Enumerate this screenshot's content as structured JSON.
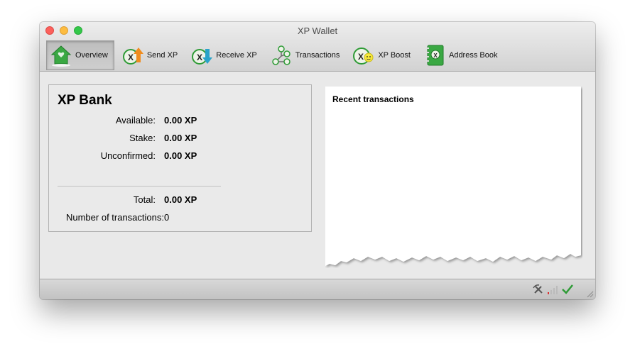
{
  "window": {
    "title": "XP Wallet"
  },
  "toolbar": {
    "items": [
      {
        "label": "Overview",
        "icon": "home-icon",
        "active": true
      },
      {
        "label": "Send XP",
        "icon": "send-coin-icon"
      },
      {
        "label": "Receive XP",
        "icon": "receive-coin-icon"
      },
      {
        "label": "Transactions",
        "icon": "transactions-tree-icon"
      },
      {
        "label": "XP Boost",
        "icon": "boost-icon"
      },
      {
        "label": "Address Book",
        "icon": "address-book-icon"
      }
    ]
  },
  "bank": {
    "title": "XP Bank",
    "available_label": "Available:",
    "available_value": "0.00 XP",
    "stake_label": "Stake:",
    "stake_value": "0.00 XP",
    "unconfirmed_label": "Unconfirmed:",
    "unconfirmed_value": "0.00 XP",
    "total_label": "Total:",
    "total_value": "0.00 XP",
    "tx_count_label": "Number of transactions:",
    "tx_count_value": "0"
  },
  "recent": {
    "title": "Recent transactions"
  },
  "status": {
    "icons": [
      "mining-pickaxe-icon",
      "signal-strength-icon",
      "synced-check-icon"
    ]
  },
  "colors": {
    "accent_green": "#2e9b36",
    "send_orange": "#f08c1e",
    "receive_teal": "#2aa3c9"
  }
}
